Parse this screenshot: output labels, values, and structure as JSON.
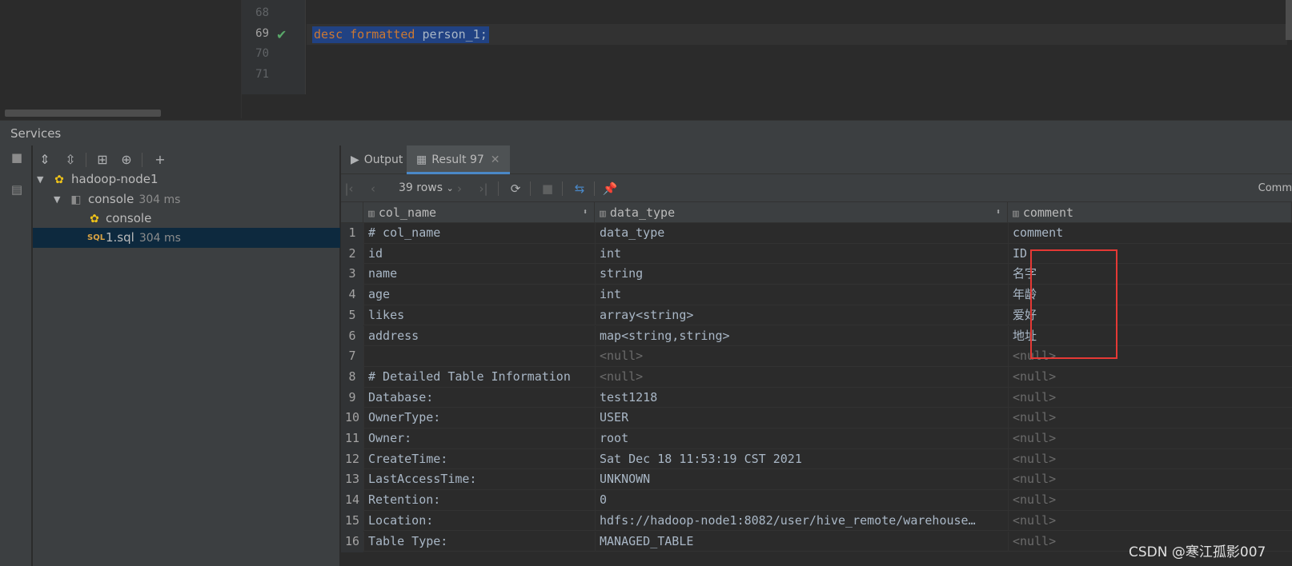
{
  "editor": {
    "lines": [
      {
        "num": "68",
        "text": ""
      },
      {
        "num": "69",
        "text": "desc formatted person_1;"
      },
      {
        "num": "70",
        "text": ""
      },
      {
        "num": "71",
        "text": ""
      }
    ],
    "code_keyword_1": "desc",
    "code_keyword_2": "formatted",
    "code_identifier": "person_1;"
  },
  "services": {
    "title": "Services",
    "tree": [
      {
        "label": "hadoop-node1",
        "meta": ""
      },
      {
        "label": "console",
        "meta": "304 ms"
      },
      {
        "label": "console",
        "meta": ""
      },
      {
        "label": "1.sql",
        "meta": "304 ms"
      }
    ]
  },
  "result": {
    "tabs": [
      {
        "label": "Output"
      },
      {
        "label": "Result 97"
      }
    ],
    "row_count_label": "39 rows",
    "right_truncated_label": "Comm",
    "columns": [
      "col_name",
      "data_type",
      "comment"
    ],
    "rows": [
      {
        "n": "1",
        "col_name": "# col_name",
        "data_type": "data_type",
        "comment": "comment"
      },
      {
        "n": "2",
        "col_name": "id",
        "data_type": "int",
        "comment": "ID"
      },
      {
        "n": "3",
        "col_name": "name",
        "data_type": "string",
        "comment": "名字"
      },
      {
        "n": "4",
        "col_name": "age",
        "data_type": "int",
        "comment": "年龄"
      },
      {
        "n": "5",
        "col_name": "likes",
        "data_type": "array<string>",
        "comment": "爱好"
      },
      {
        "n": "6",
        "col_name": "address",
        "data_type": "map<string,string>",
        "comment": "地址"
      },
      {
        "n": "7",
        "col_name": "",
        "data_type": "<null>",
        "comment": "<null>"
      },
      {
        "n": "8",
        "col_name": "# Detailed Table Information",
        "data_type": "<null>",
        "comment": "<null>"
      },
      {
        "n": "9",
        "col_name": "Database:",
        "data_type": "test1218",
        "comment": "<null>"
      },
      {
        "n": "10",
        "col_name": "OwnerType:",
        "data_type": "USER",
        "comment": "<null>"
      },
      {
        "n": "11",
        "col_name": "Owner:",
        "data_type": "root",
        "comment": "<null>"
      },
      {
        "n": "12",
        "col_name": "CreateTime:",
        "data_type": "Sat Dec 18 11:53:19 CST 2021",
        "comment": "<null>"
      },
      {
        "n": "13",
        "col_name": "LastAccessTime:",
        "data_type": "UNKNOWN",
        "comment": "<null>"
      },
      {
        "n": "14",
        "col_name": "Retention:",
        "data_type": "0",
        "comment": "<null>"
      },
      {
        "n": "15",
        "col_name": "Location:",
        "data_type": "hdfs://hadoop-node1:8082/user/hive_remote/warehouse…",
        "comment": "<null>"
      },
      {
        "n": "16",
        "col_name": "Table Type:",
        "data_type": "MANAGED_TABLE",
        "comment": "<null>"
      }
    ]
  },
  "watermark": "CSDN @寒江孤影007"
}
